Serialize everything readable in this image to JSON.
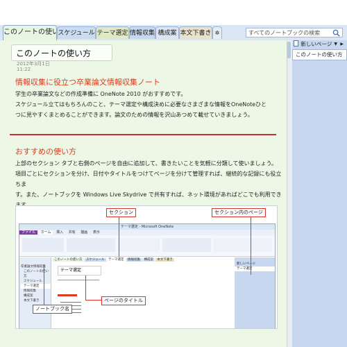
{
  "tabs": [
    {
      "label": "このノートの使い方"
    },
    {
      "label": "スケジュール"
    },
    {
      "label": "テーマ選定"
    },
    {
      "label": "情報収集"
    },
    {
      "label": "構成案"
    },
    {
      "label": "本文下書き"
    }
  ],
  "tab_add_label": "✲",
  "search": {
    "placeholder": "すべてのノートブックの検索 (Ctrl+E)"
  },
  "page": {
    "title": "このノートの使い方",
    "date": "2012年3月1日",
    "time": "11:22",
    "section1": {
      "heading": "情報収集に役立つ卒業論文情報収集ノート",
      "lines": [
        "学生の卒業論文などの作成準備に OneNote 2010 がおすすめです。",
        "スケジュール立てはもちろんのこと、テーマ選定や構成決めに必要なさまざまな情報をOneNoteひと",
        "つに見やすくまとめることができます。論文のための情報を沢山あつめて載せていきましょう。"
      ]
    },
    "section2": {
      "heading": "おすすめの使い方",
      "lines": [
        "上部のセクション タブと右側のページを自由に追加して、書きたいことを気軽に分類して使いましょう。",
        "項目ごとにセクションを分け、日付やタイトルをつけてページを分けて管理すれば、継続的な記録にも役立ちま",
        "す。また、ノートブックを Windows Live Skydrive で共有すれば、ネット環境があればどこでも利用できます。"
      ]
    },
    "screenshot": {
      "window_title": "テーマ選定 - Microsoft OneNote",
      "ribbon_tabs": [
        "ファイル",
        "ホーム",
        "挿入",
        "共有",
        "描画",
        "表示"
      ],
      "section_tabs": [
        "このノートの使い方",
        "スケジュール",
        "テーマ選定",
        "情報収集",
        "構成案",
        "本文下書き"
      ],
      "notebook_items": [
        "卒業論文情報収集",
        "このノートの使い方",
        "スケジュール",
        "テーマ選定",
        "情報収集",
        "構成案",
        "本文下書き"
      ],
      "page_title": "テーマ選定",
      "new_page": "新しいページ",
      "page_item": "テーマ選定",
      "callouts": {
        "section": "セクション",
        "page_in_section": "セクション内のページ",
        "notebook_name": "ノートブック名",
        "page_title": "ページのタイトル"
      }
    }
  },
  "right_panel": {
    "new_page": "新しいページ",
    "items": [
      {
        "label": "このノートの使い方"
      }
    ]
  }
}
